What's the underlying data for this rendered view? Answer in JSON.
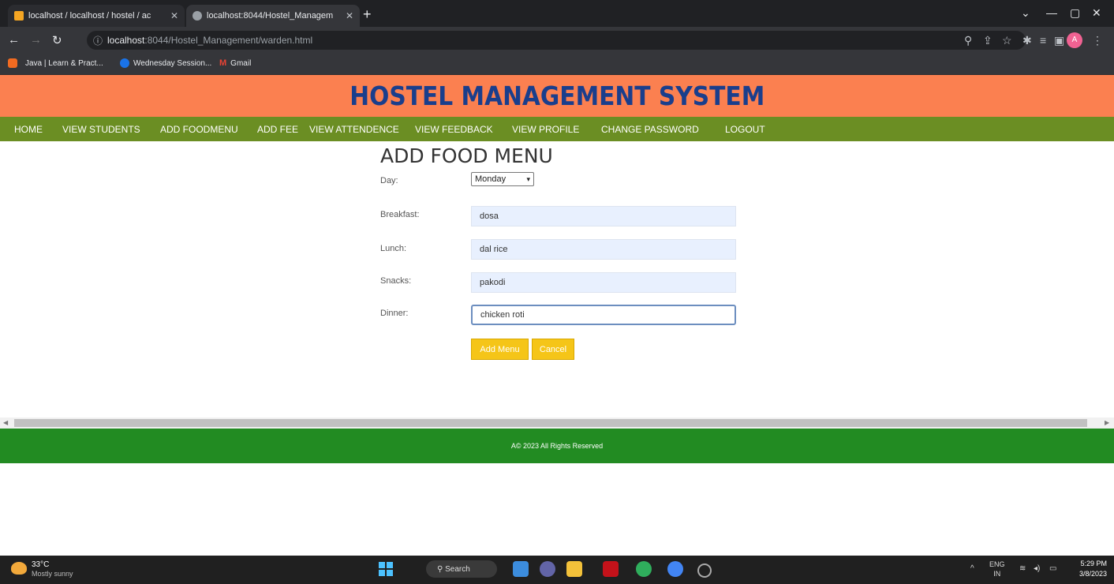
{
  "browser": {
    "tabs": [
      {
        "title": "localhost / localhost / hostel / ac",
        "active": false
      },
      {
        "title": "localhost:8044/Hostel_Managem",
        "active": true
      }
    ],
    "url_host": "localhost",
    "url_path": ":8044/Hostel_Management/warden.html",
    "bookmarks": [
      {
        "label": "Java | Learn & Pract...",
        "icon": "bookmark-java-icon",
        "color": "#f26b21"
      },
      {
        "label": "Wednesday Session...",
        "icon": "bookmark-session-icon",
        "color": "#1a73e8"
      },
      {
        "label": "Gmail",
        "icon": "gmail-icon",
        "color": "#ea4335"
      }
    ],
    "profile_initial": "A"
  },
  "page": {
    "header_title": "HOSTEL MANAGEMENT SYSTEM",
    "nav": [
      "HOME",
      "VIEW STUDENTS",
      "ADD FOODMENU",
      "ADD FEE",
      "VIEW ATTENDENCE",
      "VIEW FEEDBACK",
      "VIEW PROFILE",
      "CHANGE PASSWORD",
      "LOGOUT"
    ],
    "form": {
      "title": "ADD FOOD MENU",
      "day_label": "Day:",
      "day_value": "Monday",
      "breakfast_label": "Breakfast:",
      "breakfast_value": "dosa",
      "lunch_label": "Lunch:",
      "lunch_value": "dal rice",
      "snacks_label": "Snacks:",
      "snacks_value": "pakodi",
      "dinner_label": "Dinner:",
      "dinner_value": "chicken roti",
      "submit_label": "Add Menu",
      "cancel_label": "Cancel"
    },
    "footer_text": "A© 2023 All Rights Reserved"
  },
  "taskbar": {
    "weather_temp": "33°C",
    "weather_desc": "Mostly sunny",
    "search_label": "Search",
    "language": "ENG",
    "region": "IN",
    "time": "5:29 PM",
    "date": "3/8/2023"
  },
  "colors": {
    "header_bg": "#fb8050",
    "header_text": "#1a3e8c",
    "nav_bg": "#6b8e23",
    "footer_bg": "#228b22",
    "button_bg": "#f5c518"
  }
}
